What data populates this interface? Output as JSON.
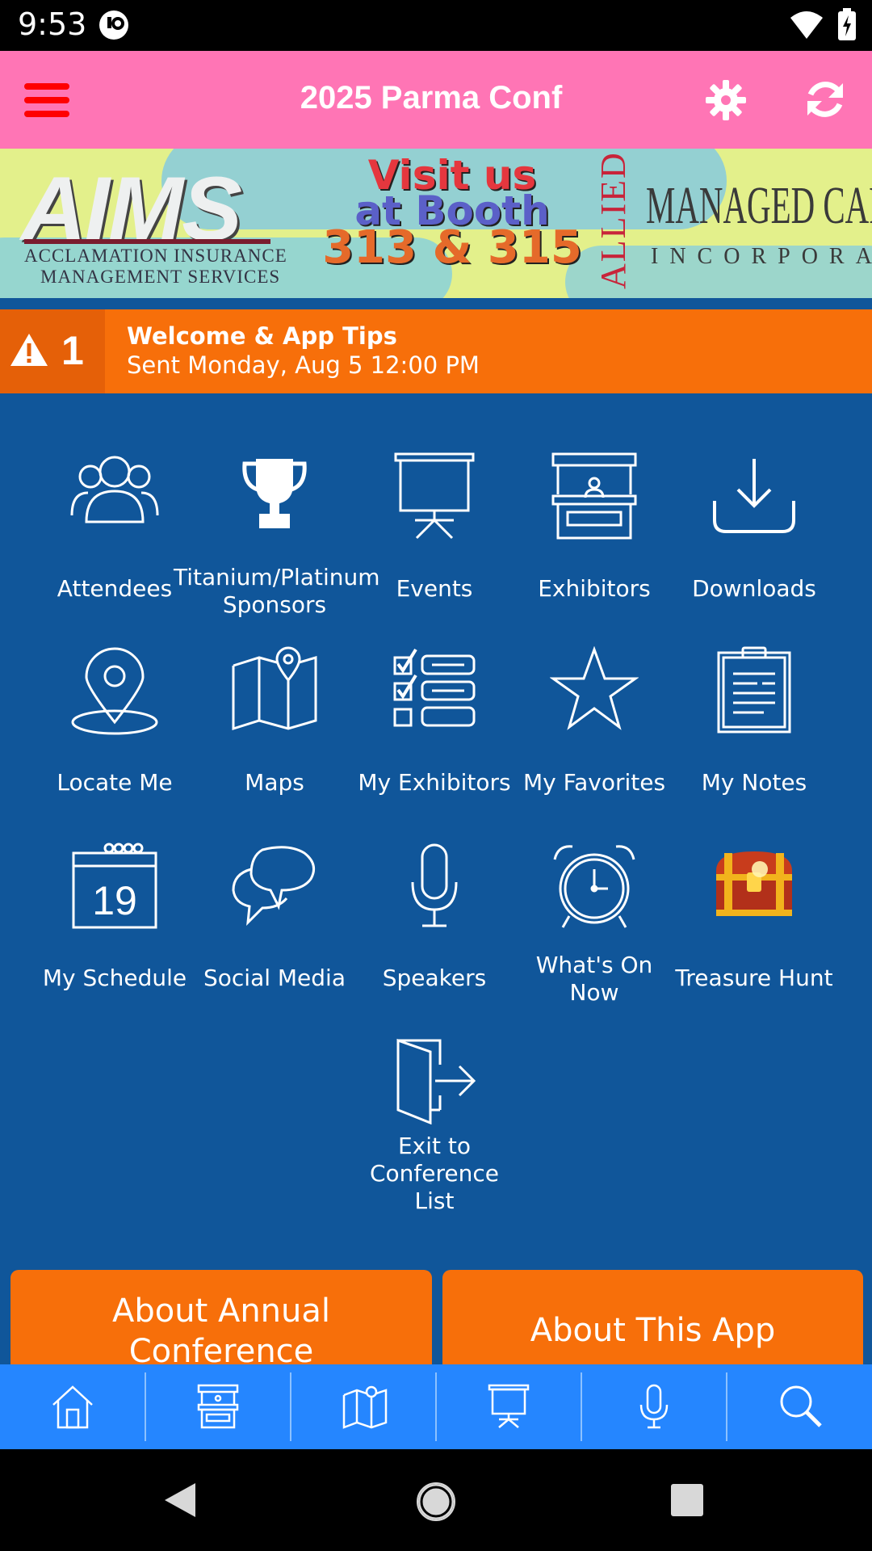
{
  "status_bar": {
    "time": "9:53"
  },
  "header": {
    "title": "2025 Parma Conf"
  },
  "banner": {
    "left_logo": "AIMS",
    "left_line1": "ACCLAMATION INSURANCE",
    "left_line2": "MANAGEMENT SERVICES",
    "visit_line1": "Visit us",
    "visit_line2": "at Booth",
    "visit_line3": "313 & 315",
    "right_vertical": "ALLIED",
    "right_main": "MANAGED CARE",
    "right_sub": "INCORPORATED"
  },
  "alert": {
    "count": "1",
    "title": "Welcome & App Tips",
    "subtitle": "Sent Monday, Aug 5 12:00 PM"
  },
  "grid": {
    "attendees": "Attendees",
    "sponsors_l1": "Titanium/Platinum",
    "sponsors_l2": "Sponsors",
    "events": "Events",
    "exhibitors": "Exhibitors",
    "downloads": "Downloads",
    "locate_me": "Locate Me",
    "maps": "Maps",
    "my_exhibitors": "My Exhibitors",
    "my_favorites": "My Favorites",
    "my_notes": "My Notes",
    "my_schedule": "My Schedule",
    "calendar_day": "19",
    "social_media": "Social Media",
    "speakers": "Speakers",
    "whats_on_l1": "What's On",
    "whats_on_l2": "Now",
    "treasure_hunt": "Treasure Hunt",
    "exit_l1": "Exit to",
    "exit_l2": "Conference",
    "exit_l3": "List"
  },
  "buttons": {
    "about_conf_l1": "About Annual",
    "about_conf_l2": "Conference",
    "about_app": "About This App"
  },
  "bottom_nav": [
    "home-icon",
    "booth-icon",
    "map-icon",
    "presentation-icon",
    "microphone-icon",
    "search-icon"
  ],
  "colors": {
    "header": "#ff75b5",
    "background": "#10569a",
    "accent_orange": "#f76f0a",
    "bottom_nav": "#2586ff",
    "menu_icon": "#ff0000"
  }
}
